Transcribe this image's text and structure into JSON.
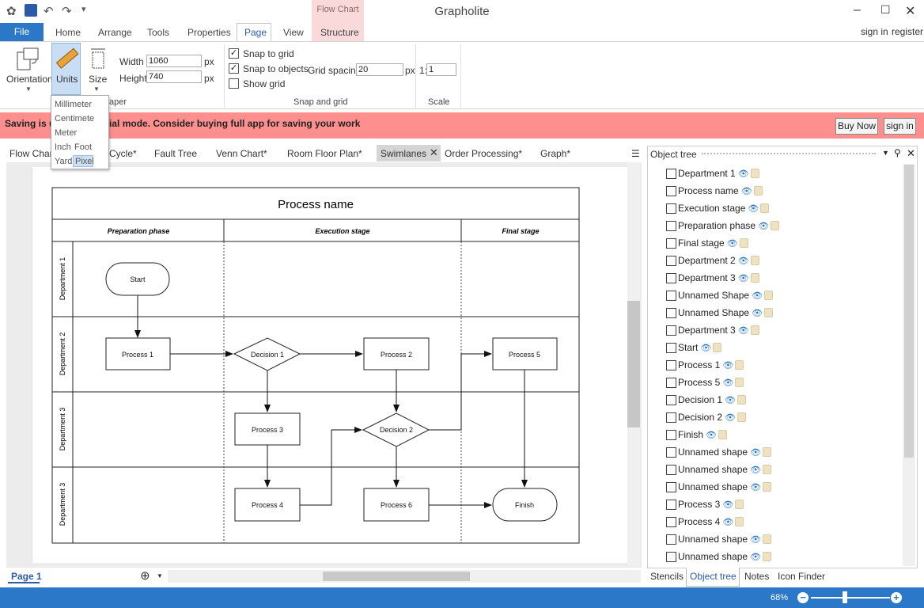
{
  "app_title": "Grapholite",
  "context_tab": "Flow Chart",
  "ribbon_tabs": {
    "file": "File",
    "home": "Home",
    "arrange": "Arrange",
    "tools": "Tools",
    "properties": "Properties",
    "page": "Page",
    "view": "View",
    "structure": "Structure"
  },
  "auth": {
    "sign_in": "sign in",
    "register": "register"
  },
  "ribbon": {
    "orientation": "Orientation",
    "units": "Units",
    "size": "Size",
    "width_label": "Width",
    "width_value": "1060",
    "height_label": "Height",
    "height_value": "740",
    "width_unit": "px",
    "height_unit": "px",
    "paper_group": "aper",
    "snap_to_grid": "Snap to grid",
    "snap_to_objects": "Snap to objects",
    "show_grid": "Show grid",
    "grid_spacing_label": "Grid spacing:",
    "grid_spacing_value": "20",
    "grid_spacing_unit": "px",
    "snap_group": "Snap and grid",
    "scale_prefix": "1:",
    "scale_value": "1",
    "scale_group": "Scale"
  },
  "units_menu": {
    "millimeter": "Millimeter",
    "centimeter": "Centimete",
    "meter": "Meter",
    "inch": "Inch",
    "foot": "Foot",
    "yard": "Yard",
    "pixel": "Pixel"
  },
  "banner": {
    "text": "Saving is u                  trial mode. Consider buying full app for saving your work",
    "buy_now": "Buy Now",
    "sign_in": "sign in"
  },
  "doc_tabs": {
    "flow_chart": "Flow Chart",
    "cycle": "Cycle*",
    "fault_tree": "Fault Tree",
    "venn_chart": "Venn Chart*",
    "room_floor_plan": "Room Floor Plan*",
    "swimlanes": "Swimlanes",
    "order_processing": "Order Processing*",
    "graph": "Graph*"
  },
  "diagram": {
    "process_name": "Process name",
    "phases": [
      "Preparation phase",
      "Execution stage",
      "Final stage"
    ],
    "lanes": [
      "Department 1",
      "Department 2",
      "Department 3",
      "Department 3"
    ],
    "shapes": {
      "start": "Start",
      "process1": "Process 1",
      "decision1": "Decision 1",
      "process2": "Process 2",
      "process5": "Process 5",
      "process3": "Process 3",
      "decision2": "Decision 2",
      "process4": "Process 4",
      "process6": "Process 6",
      "finish": "Finish"
    }
  },
  "page_tab": "Page 1",
  "object_tree": {
    "title": "Object tree",
    "items": [
      "Department 1",
      "Process name",
      "Execution stage",
      "Preparation phase",
      "Final stage",
      "Department 2",
      "Department 3",
      "Unnamed Shape",
      "Unnamed Shape",
      "Department 3",
      "Start",
      "Process 1",
      "Process 5",
      "Decision 1",
      "Decision 2",
      "Finish",
      "Unnamed shape",
      "Unnamed shape",
      "Unnamed shape",
      "Process 3",
      "Process 4",
      "Unnamed shape",
      "Unnamed shape"
    ]
  },
  "bottom_tabs": {
    "stencils": "Stencils",
    "object_tree": "Object tree",
    "notes": "Notes",
    "icon_finder": "Icon Finder"
  },
  "zoom": "68%"
}
